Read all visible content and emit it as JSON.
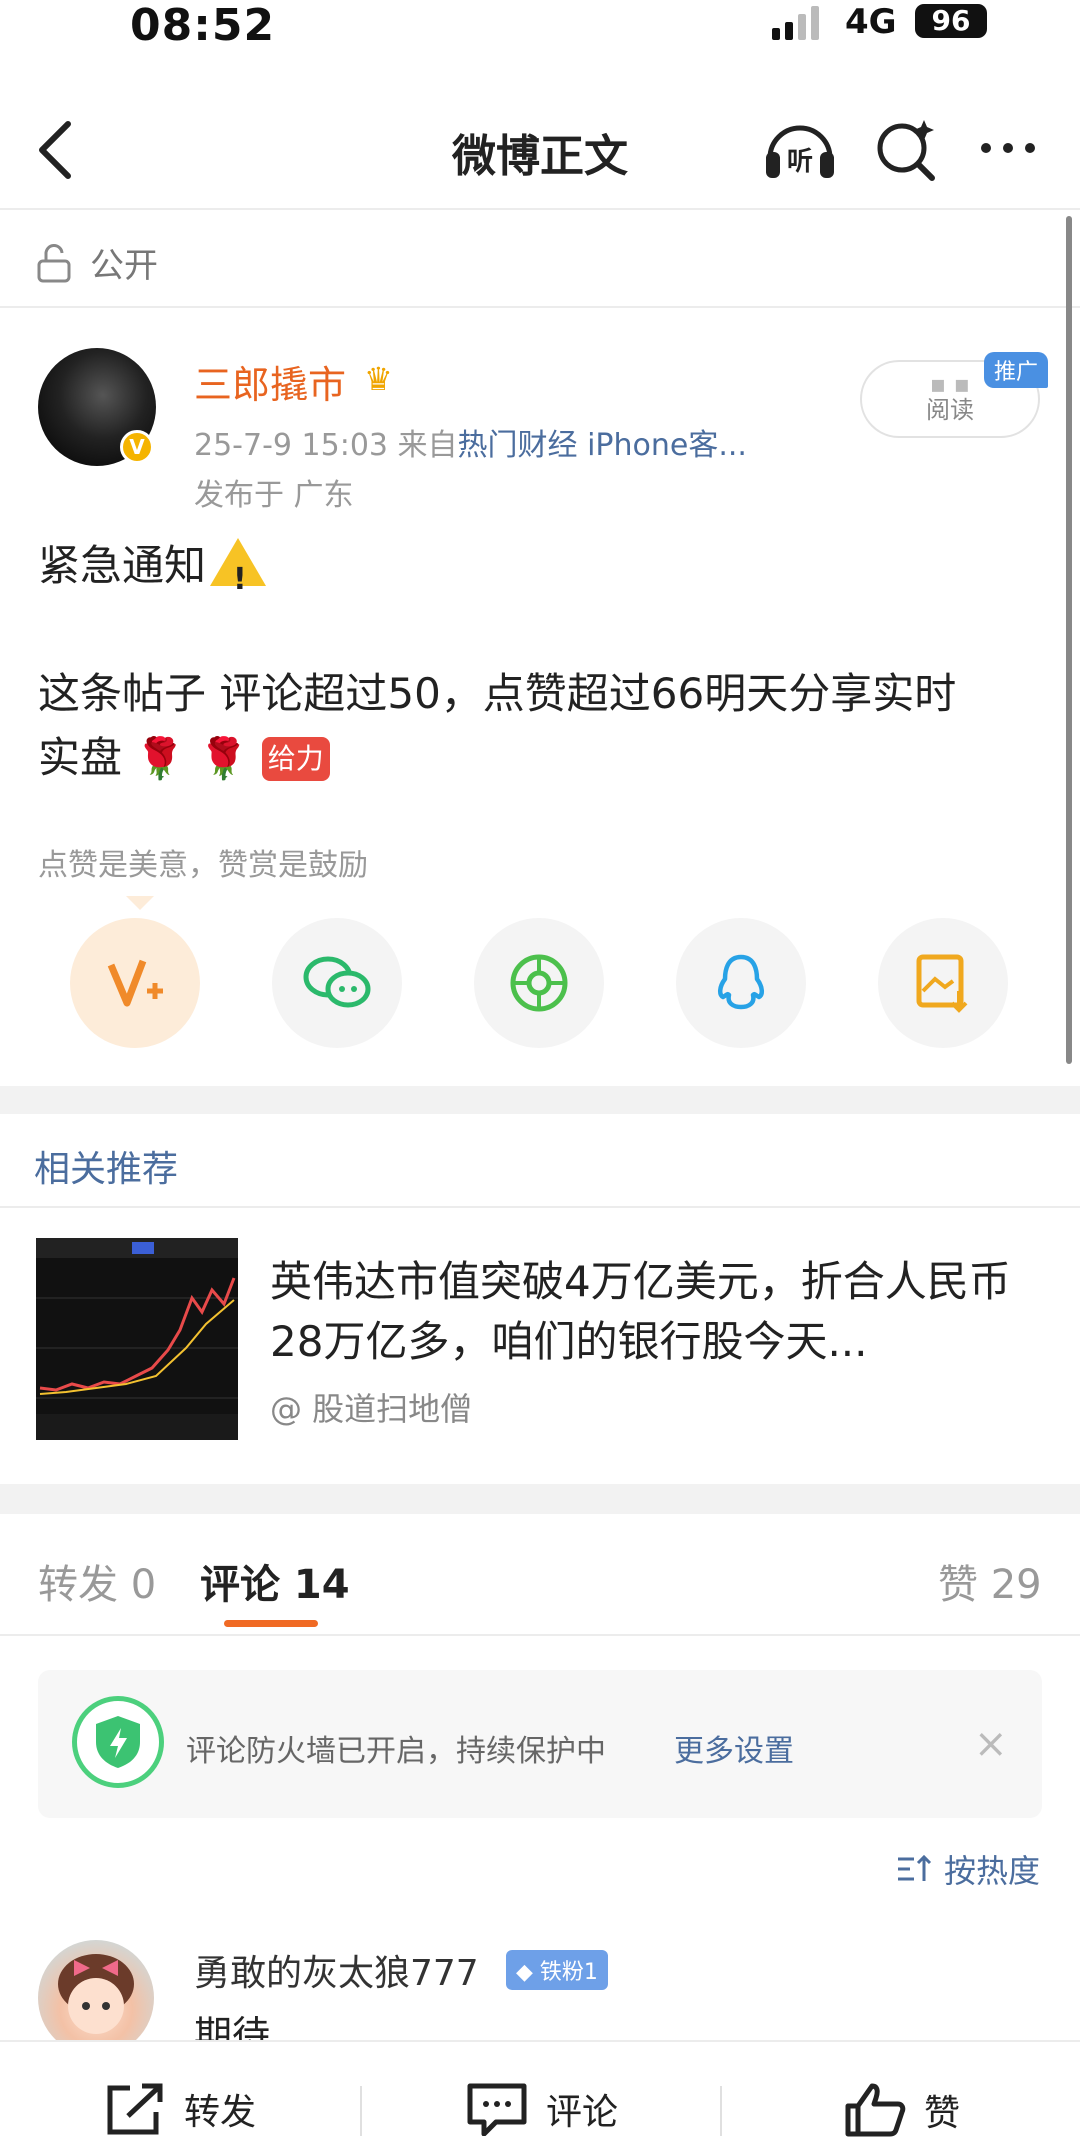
{
  "status_bar": {
    "time": "08:52",
    "network": "4G",
    "battery": "96"
  },
  "nav": {
    "title": "微博正文"
  },
  "post": {
    "visibility": "公开",
    "author": "三郎撬市",
    "verified_badge": "V",
    "time": "25-7-9 15:03",
    "source_prefix": "来自",
    "source": "热门财经 iPhone客...",
    "location": "发布于 广东",
    "read_label": "阅读",
    "promo_label": "推广",
    "line1": "紧急通知",
    "warning_mark": "!",
    "line2": "这条帖子 评论超过50，点赞超过66明天分享实时",
    "line3": "实盘",
    "gift_emoji": "给力",
    "reward_hint": "点赞是美意，赞赏是鼓励"
  },
  "share_icons": [
    "v-plus-icon",
    "wechat-icon",
    "moments-icon",
    "qq-icon",
    "save-image-icon"
  ],
  "recommend": {
    "title": "相关推荐",
    "article_title": "英伟达市值突破4万亿美元，折合人民币28万亿多，咱们的银行股今天...",
    "article_user": "@ 股道扫地僧"
  },
  "tabs": {
    "repost": "转发 0",
    "comment": "评论 14",
    "like": "赞 29"
  },
  "firewall": {
    "text": "评论防火墙已开启，持续保护中",
    "link": "更多设置",
    "close": "×"
  },
  "sort": {
    "label": "按热度"
  },
  "comment": {
    "user": "勇敢的灰太狼777",
    "fan_badge": "铁粉1",
    "text": "期待"
  },
  "bottom_bar": {
    "repost": "转发",
    "comment": "评论",
    "like": "赞"
  },
  "colors": {
    "accent_orange": "#f06a24",
    "link_blue": "#4b6d9e",
    "author_orange": "#e86420"
  }
}
